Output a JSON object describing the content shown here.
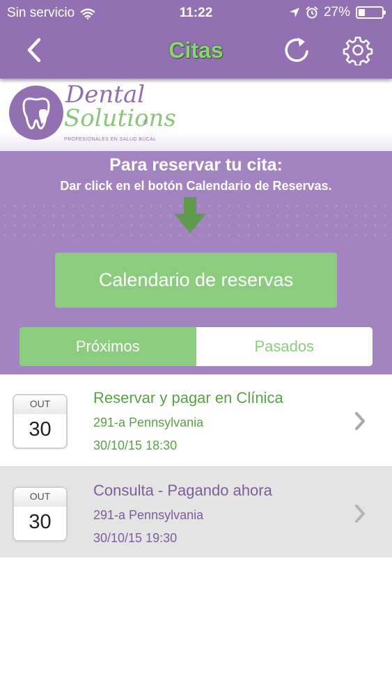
{
  "status_bar": {
    "carrier": "Sin servicio",
    "time": "11:22",
    "battery_percent": "27%",
    "battery_level": 0.27
  },
  "nav": {
    "title": "Citas"
  },
  "logo": {
    "line1": "Dental",
    "line2": "Solutions",
    "registered": "®",
    "tagline": "PROFESIONALES EN SALUD BUCAL"
  },
  "booking": {
    "title": "Para reservar tu cita:",
    "subtitle": "Dar click en el botón Calendario de Reservas.",
    "calendar_button": "Calendario de reservas",
    "tabs": [
      {
        "label": "Próximos",
        "active": true
      },
      {
        "label": "Pasados",
        "active": false
      }
    ]
  },
  "appointments": [
    {
      "month": "OUT",
      "day": "30",
      "title": "Reservar y pagar en Clínica",
      "address": "291-a Pennsylvania",
      "datetime": "30/10/15 18:30"
    },
    {
      "month": "OUT",
      "day": "30",
      "title": "Consulta - Pagando ahora",
      "address": "291-a Pennsylvania",
      "datetime": "30/10/15 19:30"
    }
  ],
  "colors": {
    "header_purple": "#9270b1",
    "section_purple": "#a384c0",
    "brand_green": "#8ccc7f",
    "text_green": "#5aa048",
    "text_purple": "#7f5c9f",
    "row_alt_gray": "#e4e4e4"
  },
  "icons": [
    "wifi-icon",
    "location-arrow-icon",
    "alarm-clock-icon",
    "battery-icon",
    "back-chevron-icon",
    "refresh-icon",
    "gear-icon",
    "arrow-down-icon",
    "chevron-right-icon"
  ]
}
